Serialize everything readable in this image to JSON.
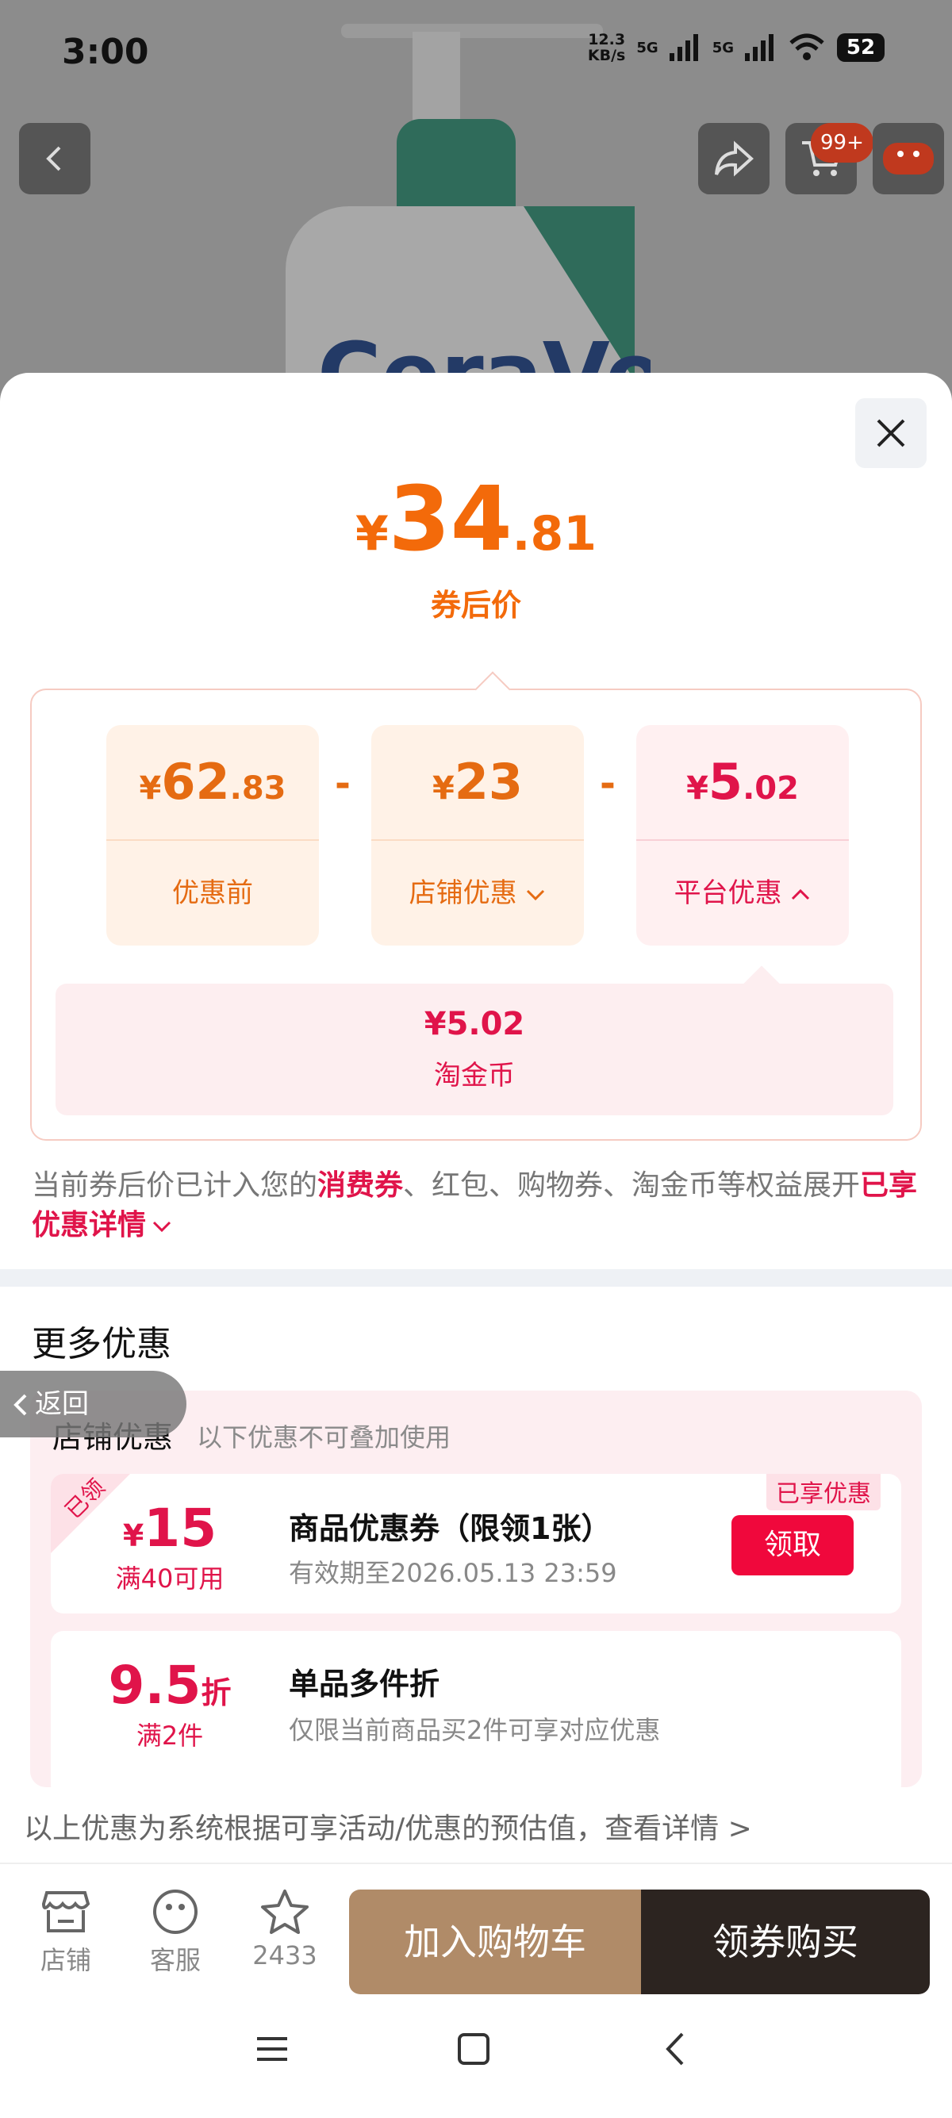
{
  "status": {
    "time": "3:00",
    "net_speed_value": "12.3",
    "net_speed_unit": "KB/s",
    "signal1": "5G",
    "signal2": "5G",
    "battery": "52"
  },
  "background": {
    "cart_badge": "99+",
    "brand_partial": "CeraVe"
  },
  "price": {
    "currency": "¥",
    "integer": "34",
    "decimal": ".81",
    "label": "券后价"
  },
  "breakdown": {
    "original": {
      "currency": "¥",
      "integer": "62",
      "decimal": ".83",
      "label": "优惠前"
    },
    "shop_discount": {
      "currency": "¥",
      "integer": "23",
      "decimal": "",
      "label": "店铺优惠"
    },
    "platform_discount": {
      "currency": "¥",
      "integer": "5",
      "decimal": ".02",
      "label": "平台优惠"
    },
    "minus": "-",
    "coin": {
      "value": "¥5.02",
      "label": "淘金币"
    }
  },
  "note": {
    "part1": "当前券后价已计入您的",
    "highlight1": "消费券",
    "part2": "、红包、购物券、淘金币等权益展开",
    "link": "已享优惠详情"
  },
  "more": {
    "title": "更多优惠",
    "shop_title": "店铺优惠",
    "shop_sub": "以下优惠不可叠加使用",
    "coupon1": {
      "ribbon": "已领",
      "currency": "¥",
      "value": "15",
      "condition": "满40可用",
      "name": "商品优惠券（限领1张）",
      "validity": "有效期至2026.05.13 23:59",
      "tag": "已享优惠",
      "button": "领取"
    },
    "coupon2": {
      "value": "9.5",
      "unit": "折",
      "condition": "满2件",
      "name": "单品多件折",
      "desc": "仅限当前商品买2件可享对应优惠"
    }
  },
  "back_pill": "返回",
  "footer_note": "以上优惠为系统根据可享活动/优惠的预估值，查看详情 >",
  "bottom_bar": {
    "shop": "店铺",
    "service": "客服",
    "favorites": "2433",
    "add_to_cart": "加入购物车",
    "buy": "领券购买"
  },
  "colors": {
    "orange": "#f36a0a",
    "red": "#e0144a",
    "cart_btn": "#b08b68",
    "buy_btn": "#2c2420"
  }
}
